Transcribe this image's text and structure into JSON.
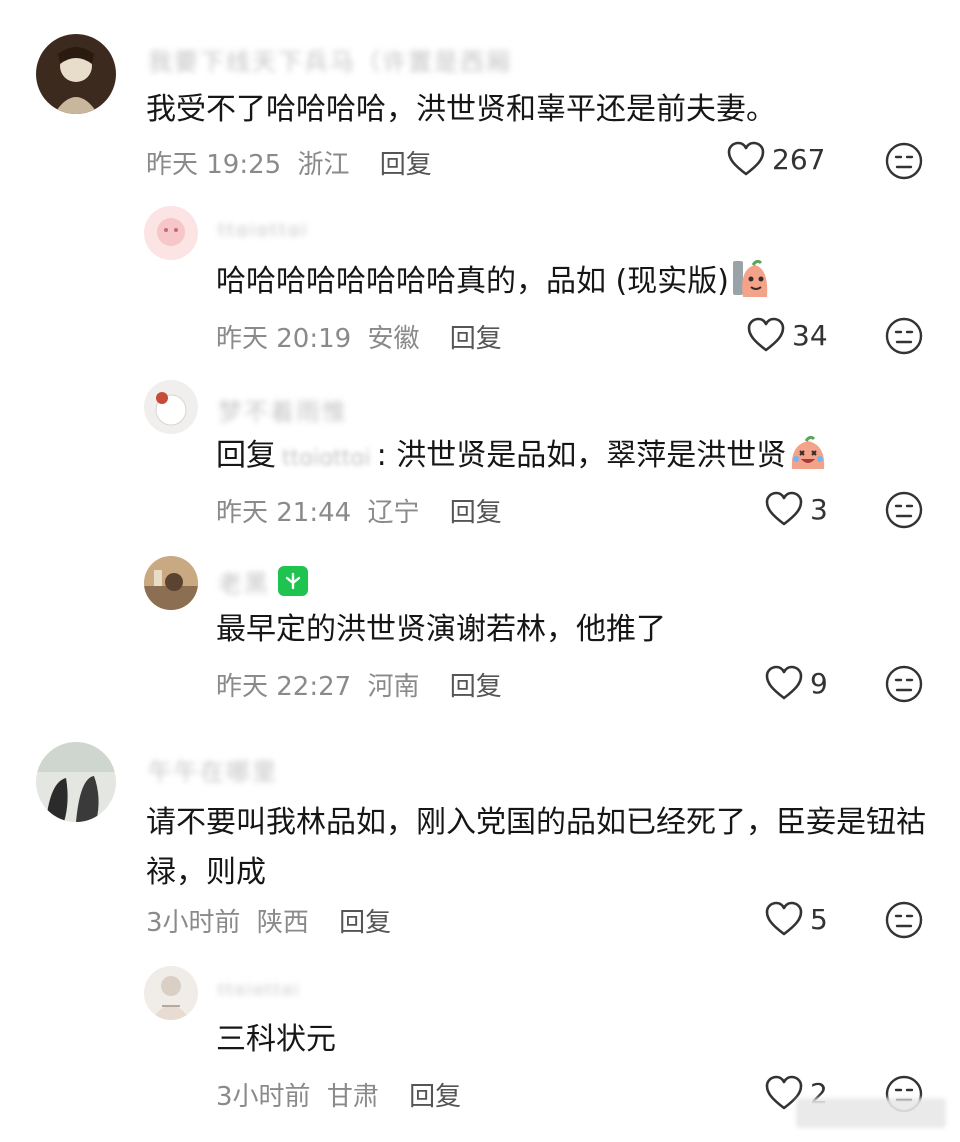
{
  "comments": [
    {
      "name": "我要下线天下兵马（许置是西厢",
      "text": "我受不了哈哈哈哈，洪世贤和辜平还是前夫妻。",
      "time": "昨天 19:25",
      "location": "浙江",
      "reply_label": "回复",
      "likes": "267"
    },
    {
      "name": "ttɑiɑttɑi",
      "text": "哈哈哈哈哈哈哈哈真的，品如 (现实版)",
      "sticker": "laughing-peach-sticker",
      "time": "昨天 20:19",
      "location": "安徽",
      "reply_label": "回复",
      "likes": "34"
    },
    {
      "name": "梦不着雨惟",
      "reply_prefix": "回复",
      "mention": "ttɑiɑttɑi",
      "text": ": 洪世贤是品如，翠萍是洪世贤",
      "sticker": "crying-laugh-sticker",
      "time": "昨天 21:44",
      "location": "辽宁",
      "reply_label": "回复",
      "likes": "3"
    },
    {
      "name": "老黑",
      "badge": "green-badge-icon",
      "text": "最早定的洪世贤演谢若林，他推了",
      "time": "昨天 22:27",
      "location": "河南",
      "reply_label": "回复",
      "likes": "9"
    },
    {
      "name": "午午在哪里",
      "text": "请不要叫我林品如，刚入党国的品如已经死了，臣妾是钮祜禄，则成",
      "time": "3小时前",
      "location": "陕西",
      "reply_label": "回复",
      "likes": "5"
    },
    {
      "name": "ttɑiɑttɑi",
      "text": "三科状元",
      "time": "3小时前",
      "location": "甘肃",
      "reply_label": "回复",
      "likes": "2"
    }
  ],
  "colors": {
    "heart": "#333333",
    "meta": "#8a8a8a",
    "badge": "#1fc450"
  }
}
